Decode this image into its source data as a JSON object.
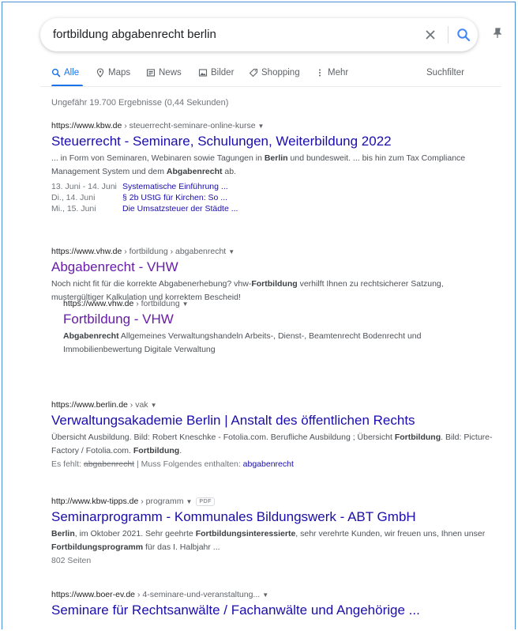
{
  "search": {
    "query": "fortbildung abgabenrecht berlin",
    "clear_icon": "close-icon",
    "search_icon": "search-icon"
  },
  "tabs": [
    {
      "label": "Alle",
      "icon": "search-icon",
      "active": true
    },
    {
      "label": "Maps",
      "icon": "map-pin-icon"
    },
    {
      "label": "News",
      "icon": "news-icon"
    },
    {
      "label": "Bilder",
      "icon": "image-icon"
    },
    {
      "label": "Shopping",
      "icon": "tag-icon"
    },
    {
      "label": "Mehr",
      "icon": "more-vertical-icon"
    }
  ],
  "suchfilter": "Suchfilter",
  "stats": "Ungefähr 19.700 Ergebnisse (0,44 Sekunden)",
  "results": [
    {
      "url_domain": "https://www.kbw.de",
      "url_path": " › steuerrecht-seminare-online-kurse",
      "title": "Steuerrecht - Seminare, Schulungen, Weiterbildung 2022",
      "snippet_1": "... in Form von Seminaren, Webinaren sowie Tagungen in ",
      "snippet_b1": "Berlin",
      "snippet_2": " und bundesweit. ... bis hin zum Tax Compliance Management System und dem ",
      "snippet_b2": "Abgabenrecht",
      "snippet_3": " ab.",
      "sitelinks": [
        {
          "date": "13. Juni - 14. Juni",
          "link": "Systematische Einführung ..."
        },
        {
          "date": "Di., 14. Juni",
          "link": "§ 2b UStG für Kirchen: So ..."
        },
        {
          "date": "Mi., 15. Juni",
          "link": "Die Umsatzsteuer der Städte ..."
        }
      ]
    },
    {
      "url_domain": "https://www.vhw.de",
      "url_path": " › fortbildung › abgabenrecht",
      "title": "Abgabenrecht - VHW",
      "snippet_1": "Noch nicht fit für die korrekte Abgabenerhebung? vhw-",
      "snippet_b1": "Fortbildung",
      "snippet_2": " verhilft Ihnen zu rechtsicherer Satzung, mustergültiger Kalkulation und korrektem Bescheid!"
    },
    {
      "url_domain": "https://www.vhw.de",
      "url_path": " › fortbildung",
      "title": "Fortbildung - VHW",
      "snippet_b1": "Abgabenrecht",
      "snippet_2": " Allgemeines Verwaltungshandeln Arbeits-, Dienst-, Beamtenrecht Bodenrecht und Immobilienbewertung Digitale Verwaltung"
    },
    {
      "url_domain": "https://www.berlin.de",
      "url_path": " › vak",
      "title": "Verwaltungsakademie Berlin | Anstalt des öffentlichen Rechts",
      "snippet_1": "Übersicht Ausbildung. Bild: Robert Kneschke - Fotolia.com. Berufliche Ausbildung ; Übersicht ",
      "snippet_b1": "Fortbildung",
      "snippet_2": ". Bild: Picture-Factory / Fotolia.com. ",
      "snippet_b2": "Fortbildung",
      "snippet_3": ".",
      "missing_label": "Es fehlt: ",
      "missing_term": "abgabenrecht",
      "missing_sep": " | Muss Folgendes enthalten: ",
      "missing_link": "abgabenrecht"
    },
    {
      "url_domain": "http://www.kbw-tipps.de",
      "url_path": " › programm",
      "badge": "PDF",
      "title": "Seminarprogramm - Kommunales Bildungswerk - ABT GmbH",
      "snippet_b1": "Berlin",
      "snippet_1": ", im Oktober 2021. Sehr geehrte ",
      "snippet_b2": "Fortbildungsinteressierte",
      "snippet_2": ", sehr verehrte Kunden, wir freuen uns, Ihnen unser ",
      "snippet_b3": "Fortbildungsprogramm",
      "snippet_3": " für das I. Halbjahr ...",
      "pages": "802 Seiten"
    },
    {
      "url_domain": "https://www.boer-ev.de",
      "url_path": " › 4-seminare-und-veranstaltung...",
      "title": "Seminare für Rechtsanwälte / Fachanwälte und Angehörige ..."
    }
  ]
}
